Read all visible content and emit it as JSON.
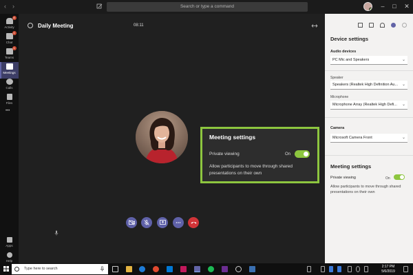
{
  "titlebar": {
    "search_placeholder": "Search or type a command",
    "back_glyph": "‹",
    "forward_glyph": "›",
    "minimize_glyph": "–",
    "maximize_glyph": "□",
    "close_glyph": "✕"
  },
  "rail": {
    "items": [
      {
        "label": "Activity",
        "badge": "8"
      },
      {
        "label": "Chat",
        "badge": "1"
      },
      {
        "label": "Teams",
        "badge": "1"
      },
      {
        "label": "Meetings",
        "badge": ""
      },
      {
        "label": "Calls",
        "badge": ""
      },
      {
        "label": "Files",
        "badge": ""
      }
    ],
    "more_label": "•••",
    "apps_label": "Apps",
    "help_label": "Help"
  },
  "meeting": {
    "title": "Daily Meeting",
    "timer": "08:11"
  },
  "popover": {
    "title": "Meeting settings",
    "toggle_label": "Private viewing",
    "toggle_state": "On",
    "description": "Allow participants to move through shared presentations on their own"
  },
  "panel": {
    "title": "Device settings",
    "audio_label": "Audio devices",
    "audio_value": "PC Mic and Speakers",
    "speaker_label": "Speaker",
    "speaker_value": "Speakers (Realtek High Definition Au...",
    "microphone_label": "Microphone",
    "microphone_value": "Microphone Array (Realtek High Defi...",
    "camera_label": "Camera",
    "camera_value": "Microsoft Camera Front",
    "meeting_settings_title": "Meeting settings",
    "private_viewing_label": "Private viewing",
    "private_viewing_state": "On",
    "private_viewing_desc": "Allow participants to move through shared presentations on their own"
  },
  "taskbar": {
    "search_placeholder": "Type here to search",
    "time": "2:17 PM",
    "date": "5/6/2019"
  },
  "colors": {
    "accent": "#6264a7",
    "toggle_on": "#8dc63f",
    "hangup": "#d13438"
  }
}
